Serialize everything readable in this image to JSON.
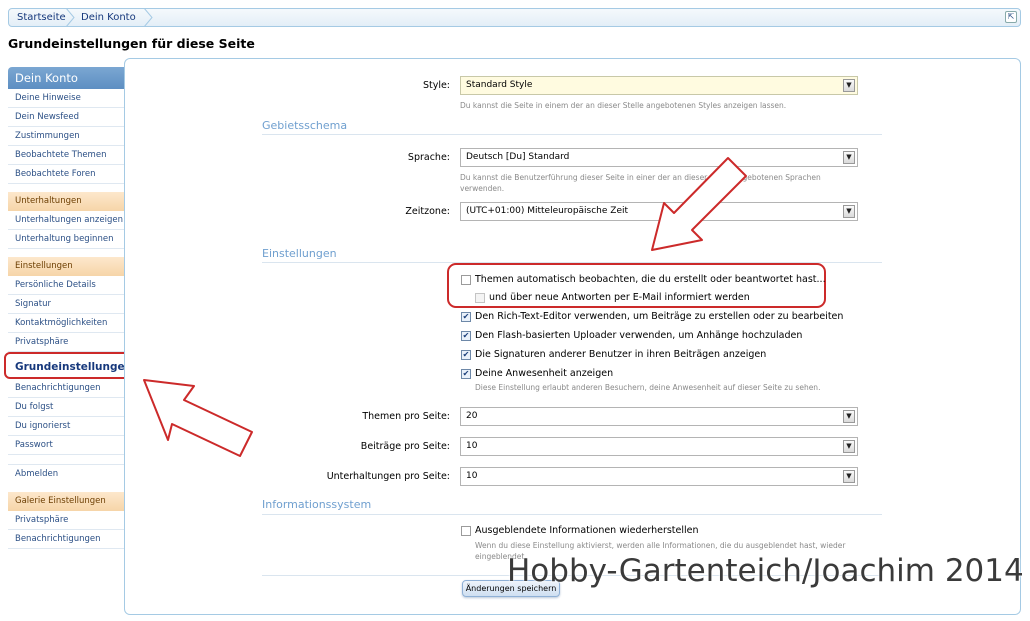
{
  "breadcrumb": {
    "items": [
      "Startseite",
      "Dein Konto"
    ],
    "jump_icon": "external-link-icon"
  },
  "page_title": "Grundeinstellungen für diese Seite",
  "sidebar": {
    "header": "Dein Konto",
    "items_1": [
      "Deine Hinweise",
      "Dein Newsfeed",
      "Zustimmungen",
      "Beobachtete Themen",
      "Beobachtete Foren"
    ],
    "cat_2": "Unterhaltungen",
    "items_2": [
      "Unterhaltungen anzeigen",
      "Unterhaltung beginnen"
    ],
    "cat_3": "Einstellungen",
    "items_3": [
      "Persönliche Details",
      "Signatur",
      "Kontaktmöglichkeiten",
      "Privatsphäre"
    ],
    "active": "Grundeinstellungen",
    "items_4": [
      "Benachrichtigungen",
      "Du folgst",
      "Du ignorierst",
      "Passwort"
    ],
    "logout": "Abmelden",
    "cat_5": "Galerie Einstellungen",
    "items_5": [
      "Privatsphäre",
      "Benachrichtigungen"
    ]
  },
  "form": {
    "style": {
      "label": "Style:",
      "value": "Standard Style",
      "hint": "Du kannst die Seite in einem der an dieser Stelle angebotenen Styles anzeigen lassen."
    },
    "section_locale": "Gebietsschema",
    "language": {
      "label": "Sprache:",
      "value": "Deutsch [Du] Standard",
      "hint1": "Du kannst die Benutzerführung dieser Seite in einer der an dieser Stelle angebotenen Sprachen",
      "hint2": "verwenden."
    },
    "timezone": {
      "label": "Zeitzone:",
      "value": "(UTC+01:00) Mitteleuropäische Zeit"
    },
    "section_settings": "Einstellungen",
    "checks": {
      "watch": {
        "label": "Themen automatisch beobachten, die du erstellt oder beantwortet hast...",
        "checked": false
      },
      "email": {
        "label": "und über neue Antworten per E-Mail informiert werden",
        "checked": false
      },
      "rte": {
        "label": "Den Rich-Text-Editor verwenden, um Beiträge zu erstellen oder zu bearbeiten",
        "checked": true
      },
      "flash": {
        "label": "Den Flash-basierten Uploader verwenden, um Anhänge hochzuladen",
        "checked": true
      },
      "signatures": {
        "label": "Die Signaturen anderer Benutzer in ihren Beiträgen anzeigen",
        "checked": true
      },
      "presence": {
        "label": "Deine Anwesenheit anzeigen",
        "checked": true,
        "hint": "Diese Einstellung erlaubt anderen Besuchern, deine Anwesenheit auf dieser Seite zu sehen."
      }
    },
    "threads_per_page": {
      "label": "Themen pro Seite:",
      "value": "20"
    },
    "posts_per_page": {
      "label": "Beiträge pro Seite:",
      "value": "10"
    },
    "conversations_per_page": {
      "label": "Unterhaltungen pro Seite:",
      "value": "10"
    },
    "section_info": "Informationssystem",
    "restore": {
      "label": "Ausgeblendete Informationen wiederherstellen",
      "checked": false,
      "hint1": "Wenn du diese Einstellung aktivierst, werden alle Informationen, die du ausgeblendet hast, wieder",
      "hint2": "eingeblendet."
    },
    "save_button": "Änderungen speichern"
  },
  "watermark": "Hobby-Gartenteich/Joachim 2014",
  "colors": {
    "accent": "#5d8ec2",
    "highlight": "#cc2a2a",
    "category": "#f6d5a8"
  }
}
